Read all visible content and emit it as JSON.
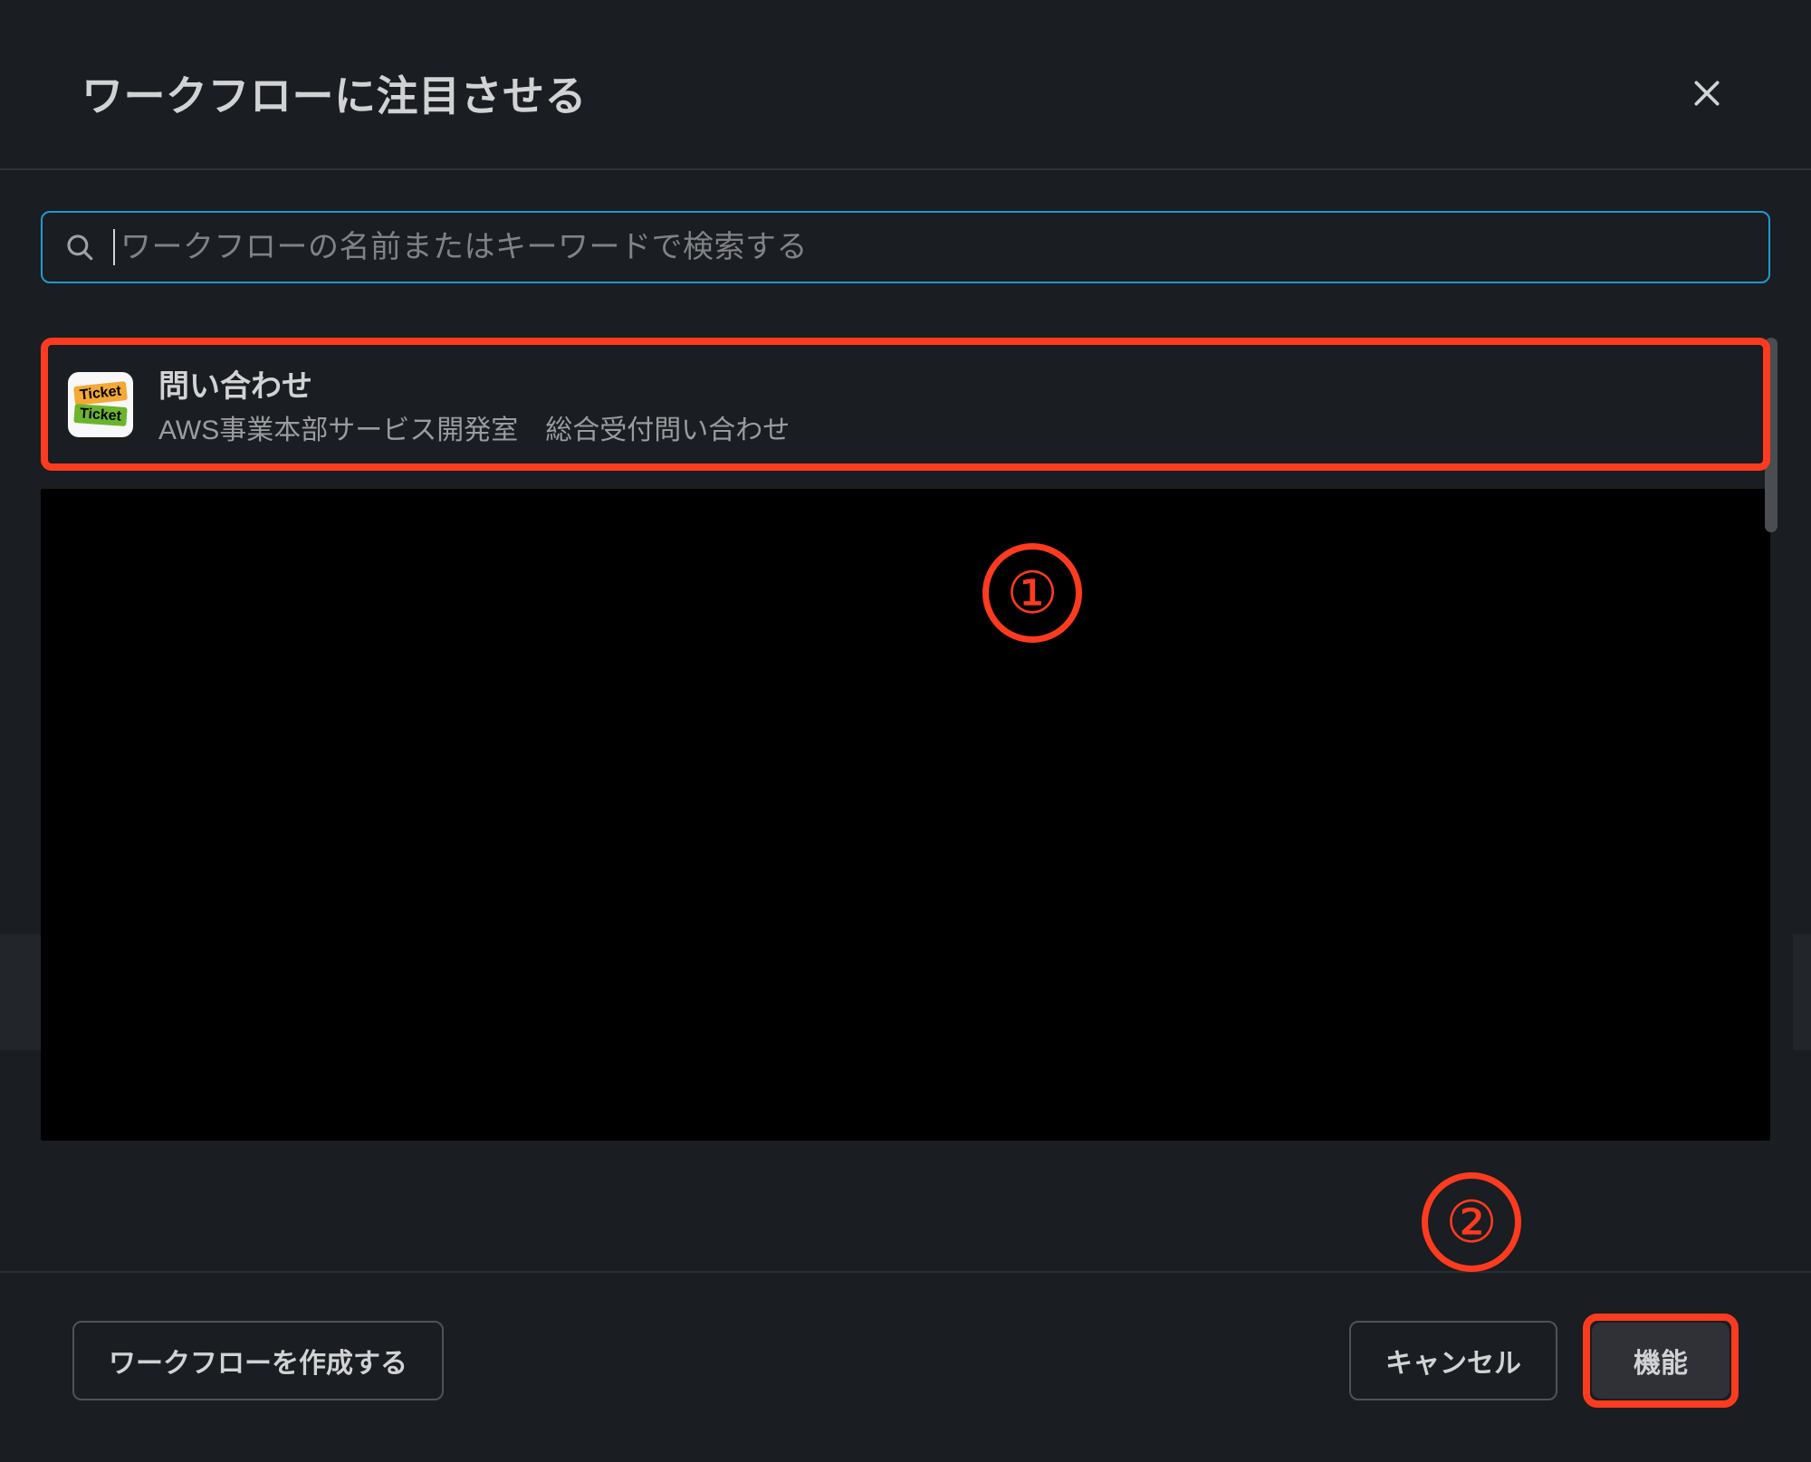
{
  "modal": {
    "title": "ワークフローに注目させる"
  },
  "search": {
    "placeholder": "ワークフローの名前またはキーワードで検索する"
  },
  "results": [
    {
      "icon_label_top": "Ticket",
      "icon_label_bottom": "Ticket",
      "title": "問い合わせ",
      "subtitle": "AWS事業本部サービス開発室　総合受付問い合わせ"
    }
  ],
  "footer": {
    "create_label": "ワークフローを作成する",
    "cancel_label": "キャンセル",
    "confirm_label": "機能"
  },
  "annotations": {
    "one": "①",
    "two": "②"
  },
  "colors": {
    "highlight": "#ff3b1f",
    "focus_border": "#1d9bd1",
    "background": "#1a1d21"
  }
}
